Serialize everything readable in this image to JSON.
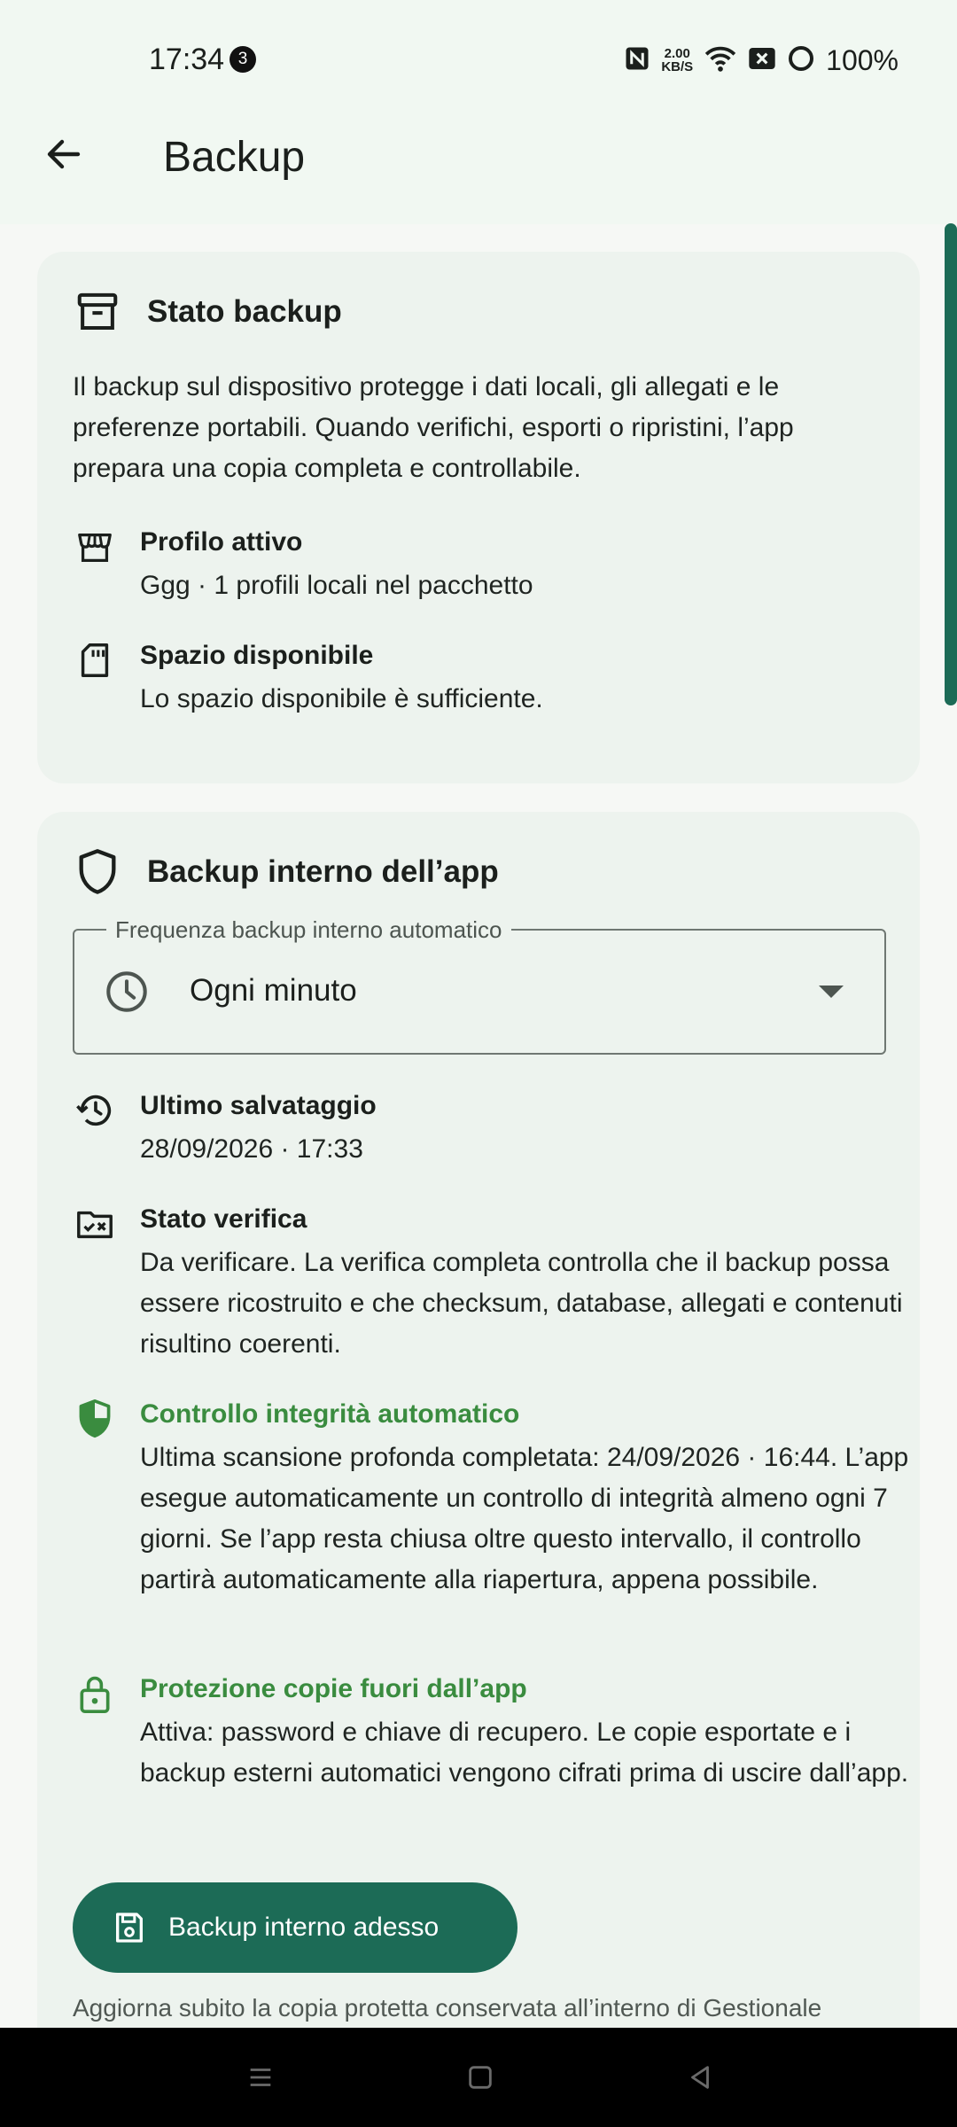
{
  "status_bar": {
    "time": "17:34",
    "notification_count": "3",
    "speed_value": "2.00",
    "speed_unit": "KB/S",
    "battery": "100%",
    "icons": [
      "nfc-icon",
      "wifi-icon",
      "no-sim-icon",
      "battery-ring-icon"
    ]
  },
  "app_bar": {
    "title": "Backup",
    "back_icon": "arrow-left-icon"
  },
  "card_status": {
    "title": "Stato backup",
    "icon": "archive-box-icon",
    "description": "Il backup sul dispositivo protegge i dati locali, gli allegati e le preferenze portabili. Quando verifichi, esporti o ripristini, l’app prepara una copia completa e controllabile.",
    "items": [
      {
        "icon": "store-icon",
        "label": "Profilo attivo",
        "value": "Ggg · 1 profili locali nel pacchetto"
      },
      {
        "icon": "sd-card-icon",
        "label": "Spazio disponibile",
        "value": "Lo spazio disponibile è sufficiente."
      }
    ]
  },
  "card_internal": {
    "title": "Backup interno dell’app",
    "icon": "shield-icon",
    "frequency_field": {
      "label": "Frequenza backup interno automatico",
      "value": "Ogni minuto",
      "icon": "clock-icon"
    },
    "items": [
      {
        "icon": "history-icon",
        "label": "Ultimo salvataggio",
        "value": "28/09/2026 · 17:33"
      },
      {
        "icon": "folder-check-icon",
        "label": "Stato verifica",
        "value": "Da verificare. La verifica completa controlla che il backup possa essere ricostruito e che checksum, database, allegati e contenuti risultino coerenti."
      },
      {
        "icon": "shield-half-icon",
        "label": "Controllo integrità automatico",
        "value": "Ultima scansione profonda completata: 24/09/2026 · 16:44. L’app esegue automaticamente un controllo di integrità almeno ogni 7 giorni. Se l’app resta chiusa oltre questo intervallo, il controllo partirà automaticamente alla riapertura, appena possibile."
      },
      {
        "icon": "lock-icon",
        "label": "Protezione copie fuori dall’app",
        "value": "Attiva: password e chiave di recupero. Le copie esportate e i backup esterni automatici vengono cifrati prima di uscire dall’app."
      }
    ],
    "button_label": "Backup interno adesso",
    "button_icon": "save-icon",
    "footnote": "Aggiorna subito la copia protetta conservata all’interno di Gestionale"
  },
  "colors": {
    "primary": "#1c6b56",
    "success_green": "#3a8c3f",
    "card_bg": "#edf3ee",
    "page_bg": "#f6f8f5"
  }
}
